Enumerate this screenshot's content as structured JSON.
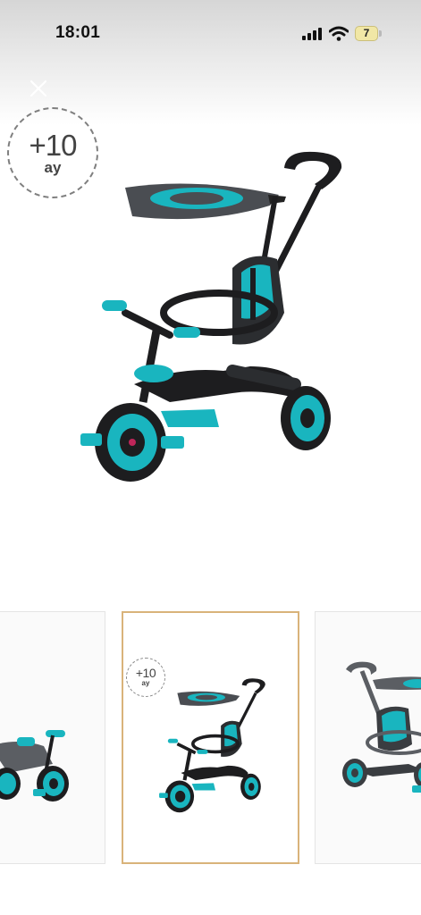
{
  "status_bar": {
    "time": "18:01",
    "battery_level": "7"
  },
  "product": {
    "age_badge_value": "+10",
    "age_badge_unit": "ay"
  },
  "thumbnails": [
    {
      "badge_value": "",
      "badge_unit": ""
    },
    {
      "badge_value": "+10",
      "badge_unit": "ay"
    },
    {
      "badge_value": "",
      "badge_unit": ""
    }
  ],
  "colors": {
    "accent": "#19b5bf",
    "frame": "#1d1d1f",
    "gray": "#5b5e63",
    "selected_border": "#d9b37a"
  },
  "icons": [
    "signal-icon",
    "wifi-icon",
    "battery-icon",
    "close-icon"
  ]
}
